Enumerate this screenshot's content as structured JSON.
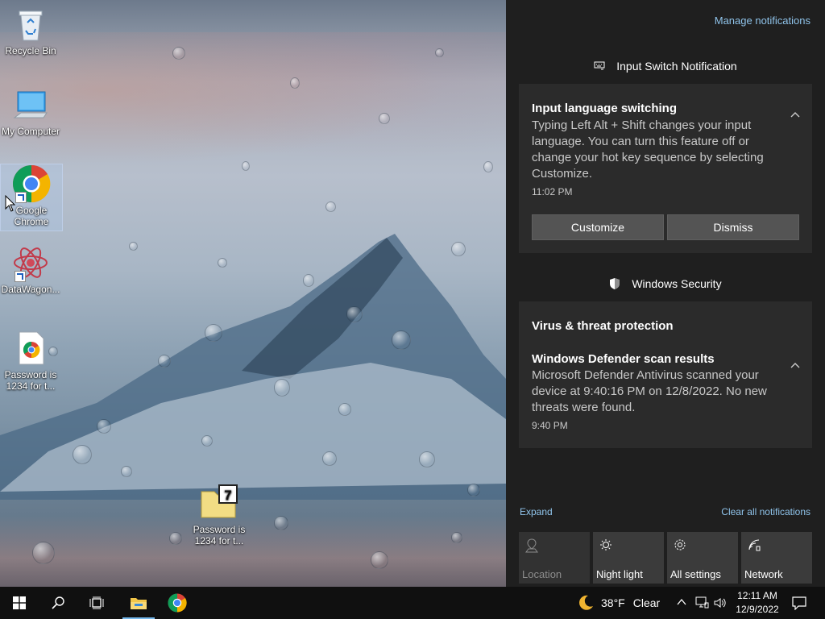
{
  "desktop": {
    "icons": [
      {
        "label": "Recycle Bin"
      },
      {
        "label": "My Computer"
      },
      {
        "label": "Google Chrome"
      },
      {
        "label": "DataWagon..."
      },
      {
        "label": "Password is 1234 for t..."
      },
      {
        "label": "Password is 1234 for t..."
      }
    ]
  },
  "action_center": {
    "manage_link": "Manage notifications",
    "group1": {
      "header": "Input Switch Notification",
      "title": "Input language switching",
      "body": "Typing Left Alt + Shift changes your input language. You can turn this feature off or change your hot key sequence by selecting Customize.",
      "time": "11:02 PM",
      "btn_customize": "Customize",
      "btn_dismiss": "Dismiss"
    },
    "group2": {
      "header": "Windows Security",
      "category": "Virus & threat protection",
      "title": "Windows Defender scan results",
      "body": "Microsoft Defender Antivirus scanned your device at 9:40:16 PM on 12/8/2022. No new threats were found.",
      "time": "9:40 PM"
    },
    "expand_link": "Expand",
    "clear_link": "Clear all notifications",
    "quick_actions": [
      {
        "label": "Location",
        "icon": "location-icon",
        "state": "off"
      },
      {
        "label": "Night light",
        "icon": "night-light-icon",
        "state": "on"
      },
      {
        "label": "All settings",
        "icon": "gear-icon",
        "state": "on"
      },
      {
        "label": "Network",
        "icon": "network-icon",
        "state": "on"
      }
    ]
  },
  "taskbar": {
    "weather_temp": "38°F",
    "weather_cond": "Clear",
    "time": "12:11 AM",
    "date": "12/9/2022",
    "accent": "#76b9ed"
  }
}
